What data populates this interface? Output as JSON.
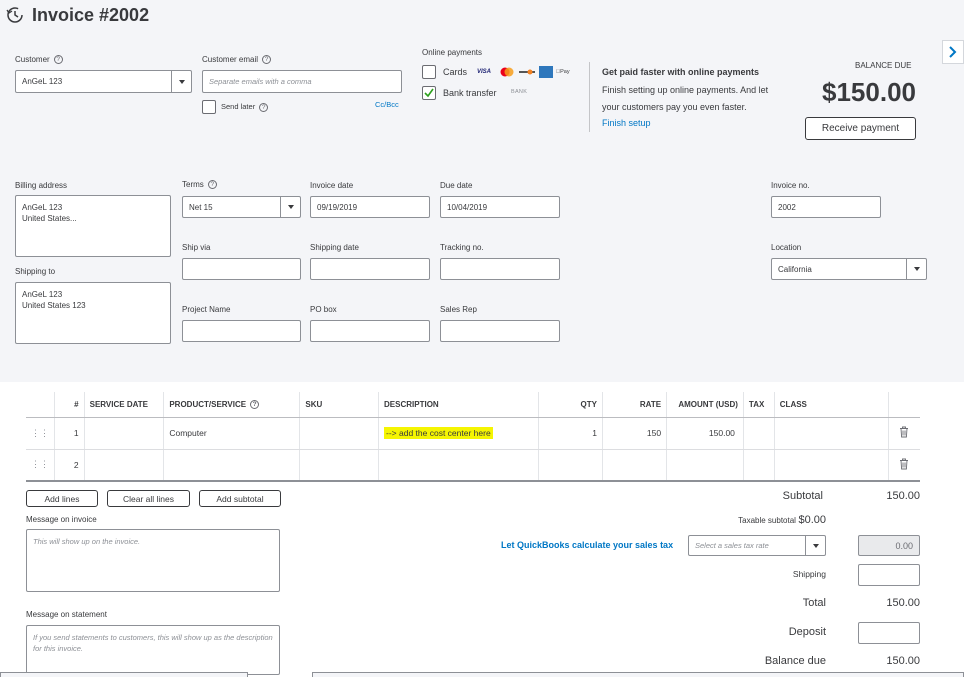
{
  "header": {
    "title": "Invoice #2002"
  },
  "customer": {
    "label": "Customer",
    "value": "AnGeL 123"
  },
  "customer_email": {
    "label": "Customer email",
    "placeholder": "Separate emails with a comma",
    "send_later": "Send later",
    "cc_bcc": "Cc/Bcc"
  },
  "online_payments": {
    "label": "Online payments",
    "cards_label": "Cards",
    "card_brands": [
      "VISA",
      "MC",
      "DISC",
      "AMEX",
      "Pay"
    ],
    "bank_label": "Bank transfer",
    "bank_badge": "BANK",
    "bank_checked": true,
    "cards_checked": false
  },
  "promo": {
    "title": "Get paid faster with online payments",
    "body": "Finish setting up online payments. And let your customers pay you even faster.",
    "link": "Finish setup"
  },
  "balance": {
    "label": "BALANCE DUE",
    "amount": "$150.00",
    "receive_button": "Receive payment"
  },
  "billing": {
    "label": "Billing address",
    "value": "AnGeL 123\nUnited States..."
  },
  "shipping_to": {
    "label": "Shipping to",
    "value": "AnGeL 123\nUnited States 123"
  },
  "terms": {
    "label": "Terms",
    "value": "Net 15"
  },
  "invoice_date": {
    "label": "Invoice date",
    "value": "09/19/2019"
  },
  "due_date": {
    "label": "Due date",
    "value": "10/04/2019"
  },
  "invoice_no": {
    "label": "Invoice no.",
    "value": "2002"
  },
  "ship_via": {
    "label": "Ship via",
    "value": ""
  },
  "shipping_date": {
    "label": "Shipping date",
    "value": ""
  },
  "tracking_no": {
    "label": "Tracking no.",
    "value": ""
  },
  "location": {
    "label": "Location",
    "value": "California"
  },
  "project_name": {
    "label": "Project Name",
    "value": ""
  },
  "po_box": {
    "label": "PO box",
    "value": ""
  },
  "sales_rep": {
    "label": "Sales Rep",
    "value": ""
  },
  "table": {
    "columns": [
      "#",
      "SERVICE DATE",
      "PRODUCT/SERVICE",
      "SKU",
      "DESCRIPTION",
      "QTY",
      "RATE",
      "AMOUNT (USD)",
      "TAX",
      "CLASS"
    ],
    "rows": [
      {
        "num": "1",
        "service_date": "",
        "product": "Computer",
        "sku": "",
        "description": "--> add the cost center here",
        "qty": "1",
        "rate": "150",
        "amount": "150.00",
        "tax": "",
        "class": ""
      },
      {
        "num": "2",
        "service_date": "",
        "product": "",
        "sku": "",
        "description": "",
        "qty": "",
        "rate": "",
        "amount": "",
        "tax": "",
        "class": ""
      }
    ]
  },
  "actions": {
    "add_lines": "Add lines",
    "clear_all": "Clear all lines",
    "add_subtotal": "Add subtotal"
  },
  "message_invoice": {
    "label": "Message on invoice",
    "placeholder": "This will show up on the invoice."
  },
  "message_statement": {
    "label": "Message on statement",
    "placeholder": "If you send statements to customers, this will show up as the description for this invoice."
  },
  "totals": {
    "subtotal_label": "Subtotal",
    "subtotal": "150.00",
    "taxable_label": "Taxable subtotal",
    "taxable": "$0.00",
    "tax_link": "Let QuickBooks calculate your sales tax",
    "tax_rate_placeholder": "Select a sales tax rate",
    "tax_value": "0.00",
    "shipping_label": "Shipping",
    "total_label": "Total",
    "total": "150.00",
    "deposit_label": "Deposit",
    "balance_due_label": "Balance due",
    "balance_due": "150.00"
  },
  "colors": {
    "link": "#0077c5",
    "highlight": "#f5f502",
    "checkbox": "#2ca01c"
  }
}
